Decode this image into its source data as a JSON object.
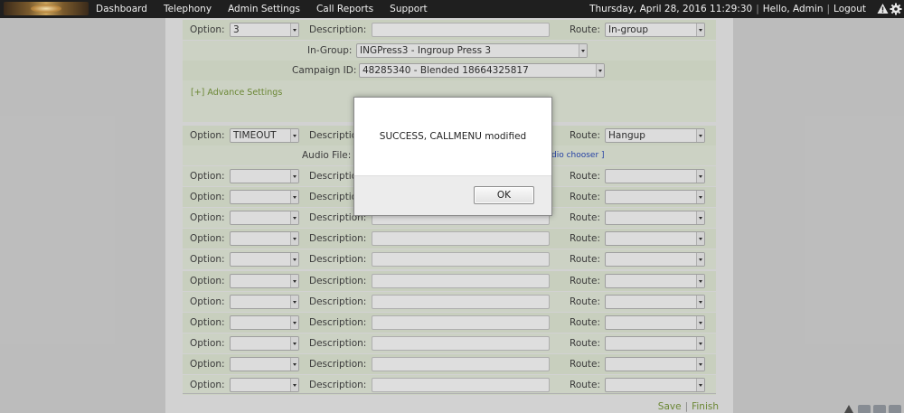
{
  "topbar": {
    "nav": [
      "Dashboard",
      "Telephony",
      "Admin Settings",
      "Call Reports",
      "Support"
    ],
    "datetime": "Thursday, April 28, 2016 11:29:30",
    "greeting": "Hello, Admin",
    "logout": "Logout",
    "alert_icon": "warning-icon",
    "settings_icon": "gear-icon"
  },
  "form": {
    "option_label": "Option:",
    "description_label": "Description:",
    "route_label": "Route:",
    "top_row": {
      "option": "3",
      "description": "",
      "route": "In-group"
    },
    "ingroup_label": "In-Group:",
    "ingroup_value": "INGPress3 - Ingroup Press 3",
    "campaign_label": "Campaign ID:",
    "campaign_value": "48285340 - Blended 18664325817",
    "advance_settings": "[+] Advance Settings",
    "timeout_row": {
      "option": "TIMEOUT",
      "description": "",
      "route": "Hangup"
    },
    "audio_file_label": "Audio File:",
    "audio_chooser_link": "dio chooser ]",
    "empty_rows": 11
  },
  "modal": {
    "message": "SUCCESS, CALLMENU modified",
    "ok_label": "OK"
  },
  "footer": {
    "save": "Save",
    "finish": "Finish",
    "separator": "|"
  },
  "colors": {
    "topbar": "#1f1f1f",
    "row_bg": "#e4ecd9",
    "accent_green": "#7a9a3c",
    "link_blue": "#2a4bbb"
  }
}
